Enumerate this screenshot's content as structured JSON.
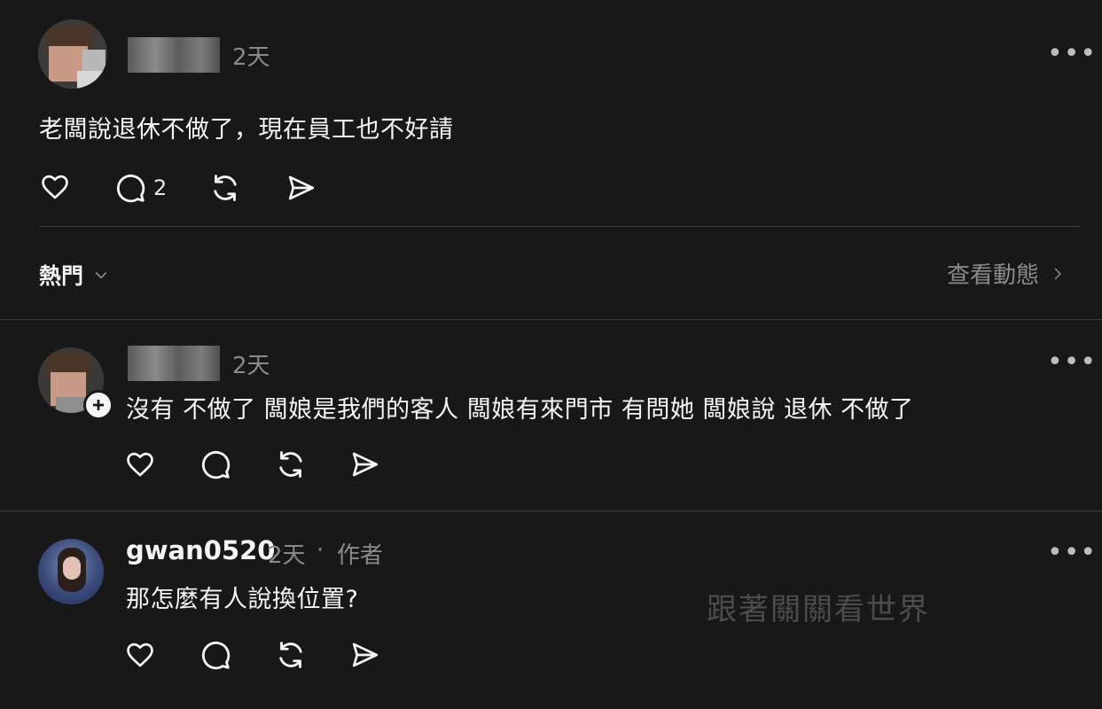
{
  "post": {
    "time": "2天",
    "text": "老闆說退休不做了，現在員工也不好請",
    "reply_count": "2"
  },
  "filter": {
    "label": "熱門",
    "view_activity": "查看動態"
  },
  "comments": [
    {
      "time": "2天",
      "text": "沒有 不做了 闆娘是我們的客人 闆娘有來門市 有問她 闆娘說 退休 不做了"
    },
    {
      "username": "gwan0520",
      "time": "2天",
      "separator": "·",
      "author_badge": "作者",
      "text": "那怎麼有人說換位置?"
    }
  ],
  "watermark": "跟著關關看世界",
  "icons": {
    "like": "heart-icon",
    "reply": "comment-icon",
    "repost": "repost-icon",
    "share": "send-icon",
    "more": "more-icon",
    "chevron_down": "chevron-down-icon",
    "chevron_right": "chevron-right-icon",
    "follow": "plus-icon"
  }
}
